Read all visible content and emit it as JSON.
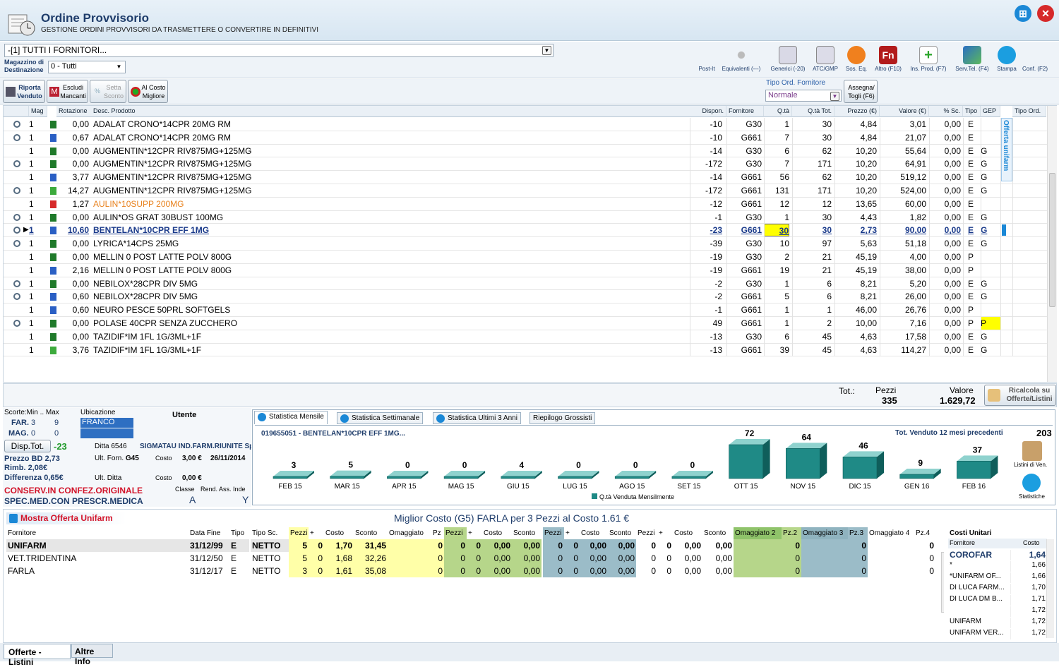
{
  "header": {
    "title": "Ordine Provvisorio",
    "subtitle": "GESTIONE ORDINI PROVVISORI DA TRASMETTERE O CONVERTIRE IN DEFINITIVI"
  },
  "toolbar": {
    "fornitori": "-[1] TUTTI I FORNITORI...",
    "mag_label": "Magazzino di Destinazione",
    "mag_value": "0 - Tutti",
    "tools": [
      "Post-It",
      "Equivalenti (---)",
      "Generici (-20)",
      "ATC/GMP",
      "Sos. Eq.",
      "Altro (F10)",
      "Ins. Prod. (F7)",
      "Serv.Tel. (F4)",
      "Stampa",
      "Conf. (F2)"
    ]
  },
  "bar2": {
    "riporta": "Riporta Venduto",
    "escludi": "Escludi Mancanti",
    "setta": "Setta Sconto",
    "alcosto": "Al Costo Migliore",
    "tipo_ord_label": "Tipo Ord. Fornitore",
    "tipo_ord_value": "Normale",
    "assegna": "Assegna/ Togli (F6)"
  },
  "grid": {
    "headers": [
      "Mag",
      "Rotazione",
      "Desc. Prodotto",
      "Dispon.",
      "Fornitore",
      "Q.tà",
      "Q.tà Tot.",
      "Prezzo (€)",
      "Valore (€)",
      "% Sc.",
      "Tipo",
      "GEP",
      "Tipo Ord."
    ],
    "side_label": "Offerta unifarm",
    "rows": [
      [
        "1",
        "0,00",
        "ADALAT CRONO*14CPR 20MG RM",
        "-10",
        "G30",
        "1",
        "30",
        "4,84",
        "3,01",
        "0,00",
        "E",
        ""
      ],
      [
        "1",
        "0,67",
        "ADALAT CRONO*14CPR 20MG RM",
        "-10",
        "G661",
        "7",
        "30",
        "4,84",
        "21,07",
        "0,00",
        "E",
        ""
      ],
      [
        "1",
        "0,00",
        "AUGMENTIN*12CPR RIV875MG+125MG",
        "-14",
        "G30",
        "6",
        "62",
        "10,20",
        "55,64",
        "0,00",
        "E",
        "G"
      ],
      [
        "1",
        "0,00",
        "AUGMENTIN*12CPR RIV875MG+125MG",
        "-172",
        "G30",
        "7",
        "171",
        "10,20",
        "64,91",
        "0,00",
        "E",
        "G"
      ],
      [
        "1",
        "3,77",
        "AUGMENTIN*12CPR RIV875MG+125MG",
        "-14",
        "G661",
        "56",
        "62",
        "10,20",
        "519,12",
        "0,00",
        "E",
        "G"
      ],
      [
        "1",
        "14,27",
        "AUGMENTIN*12CPR RIV875MG+125MG",
        "-172",
        "G661",
        "131",
        "171",
        "10,20",
        "524,00",
        "0,00",
        "E",
        "G"
      ],
      [
        "1",
        "1,27",
        "AULIN*10SUPP 200MG",
        "-12",
        "G661",
        "12",
        "12",
        "13,65",
        "60,00",
        "0,00",
        "E",
        ""
      ],
      [
        "1",
        "0,00",
        "AULIN*OS GRAT 30BUST 100MG",
        "-1",
        "G30",
        "1",
        "30",
        "4,43",
        "1,82",
        "0,00",
        "E",
        "G"
      ],
      [
        "1",
        "10,60",
        "BENTELAN*10CPR EFF 1MG",
        "-23",
        "G661",
        "30",
        "30",
        "2,73",
        "90,00",
        "0,00",
        "E",
        "G"
      ],
      [
        "1",
        "0,00",
        "LYRICA*14CPS 25MG",
        "-39",
        "G30",
        "10",
        "97",
        "5,63",
        "51,18",
        "0,00",
        "E",
        "G"
      ],
      [
        "1",
        "0,00",
        "MELLIN 0 POST LATTE POLV 800G",
        "-19",
        "G30",
        "2",
        "21",
        "45,19",
        "4,00",
        "0,00",
        "P",
        ""
      ],
      [
        "1",
        "2,16",
        "MELLIN 0 POST LATTE POLV 800G",
        "-19",
        "G661",
        "19",
        "21",
        "45,19",
        "38,00",
        "0,00",
        "P",
        ""
      ],
      [
        "1",
        "0,00",
        "NEBILOX*28CPR DIV 5MG",
        "-2",
        "G30",
        "1",
        "6",
        "8,21",
        "5,20",
        "0,00",
        "E",
        "G"
      ],
      [
        "1",
        "0,60",
        "NEBILOX*28CPR DIV 5MG",
        "-2",
        "G661",
        "5",
        "6",
        "8,21",
        "26,00",
        "0,00",
        "E",
        "G"
      ],
      [
        "1",
        "0,60",
        "NEURO PESCE 50PRL SOFTGELS",
        "-1",
        "G661",
        "1",
        "1",
        "46,00",
        "26,76",
        "0,00",
        "P",
        ""
      ],
      [
        "1",
        "0,00",
        "POLASE 40CPR SENZA ZUCCHERO",
        "49",
        "G661",
        "1",
        "2",
        "10,00",
        "7,16",
        "0,00",
        "P",
        "P"
      ],
      [
        "1",
        "0,00",
        "TAZIDIF*IM 1FL 1G/3ML+1F",
        "-13",
        "G30",
        "6",
        "45",
        "4,63",
        "17,58",
        "0,00",
        "E",
        "G"
      ],
      [
        "1",
        "3,76",
        "TAZIDIF*IM 1FL 1G/3ML+1F",
        "-13",
        "G661",
        "39",
        "45",
        "4,63",
        "114,27",
        "0,00",
        "E",
        "G"
      ]
    ]
  },
  "totals": {
    "tot_label": "Tot.:",
    "pezzi_label": "Pezzi",
    "pezzi": "335",
    "valore_label": "Valore",
    "valore": "1.629,72",
    "ricalcola": "Ricalcola su Offerte/Listini"
  },
  "info": {
    "scorte": "Scorte:Min .. Max",
    "ubicazione": "Ubicazione",
    "utente": "Utente",
    "far": "FAR.",
    "far_min": "3",
    "far_max": "9",
    "far_ubic": "FRANCO",
    "mag": "MAG.",
    "mag_min": "0",
    "mag_max": "0",
    "disp_btn": "Disp.Tot.",
    "disp_val": "-23",
    "ditta_label": "Ditta 6546",
    "ditta": "SIGMATAU IND.FARM.RIUNITE Sp",
    "prezzo_bd_label": "Prezzo BD",
    "prezzo_bd": "2,73",
    "ult_forn_label": "Ult. Forn.",
    "ult_forn": "G45",
    "costo_label": "Costo",
    "costo1": "3,00 €",
    "data1": "26/11/2014",
    "rimb_label": "Rimb.",
    "rimb": "2,08€",
    "differenza_label": "Differenza",
    "differenza": "0,65€",
    "ult_ditta_label": "Ult. Ditta",
    "costo2": "0,00 €",
    "conserv": "CONSERV.IN CONFEZ.ORIGINALE",
    "spec": "SPEC.MED.CON PRESCR.MEDICA",
    "classe_label": "Classe",
    "classe": "A",
    "rend_label": "Rend. Ass. Inde",
    "rend": "Y"
  },
  "stats": {
    "tabs": [
      "Statistica Mensile",
      "Statistica Settimanale",
      "Statistica Ultimi 3 Anni",
      "Riepilogo Grossisti"
    ],
    "product": "019655051 - BENTELAN*10CPR EFF 1MG...",
    "tot_label": "Tot. Venduto 12 mesi precedenti",
    "tot": "203",
    "listini": "Listini di Ven.",
    "statistiche": "Statistiche"
  },
  "chart_data": {
    "type": "bar",
    "categories": [
      "FEB 15",
      "MAR 15",
      "APR 15",
      "MAG 15",
      "GIU 15",
      "LUG 15",
      "AGO 15",
      "SET 15",
      "OTT 15",
      "NOV 15",
      "DIC 15",
      "GEN 16",
      "FEB 16"
    ],
    "series": [
      {
        "name": "Q.tà Venduta Mensilmente",
        "values": [
          3,
          5,
          0,
          0,
          4,
          0,
          0,
          0,
          72,
          64,
          46,
          9,
          37
        ]
      }
    ],
    "color": "#1f8a86"
  },
  "offer": {
    "mostra": "Mostra Offerta Unifarm",
    "title": "Miglior Costo (G5) FARLA per 3 Pezzi al Costo 1.61 €",
    "headers": [
      "Fornitore",
      "Data Fine",
      "Tipo",
      "Tipo Sc.",
      "Pezzi",
      "+",
      "Costo",
      "Sconto",
      "Omaggiato",
      "Pz",
      "Pezzi",
      "+",
      "Costo",
      "Sconto",
      "Pezzi",
      "+",
      "Costo",
      "Sconto",
      "Pezzi",
      "+",
      "Costo",
      "Sconto",
      "Omaggiato 2",
      "Pz.2",
      "Omaggiato 3",
      "Pz.3",
      "Omaggiato 4",
      "Pz.4"
    ],
    "rows": [
      [
        "UNIFARM",
        "31/12/99",
        "E",
        "NETTO",
        "5",
        "0",
        "1,70",
        "31,45",
        "",
        "0",
        "0",
        "0",
        "0,00",
        "0,00",
        "0",
        "0",
        "0,00",
        "0,00",
        "0",
        "0",
        "0,00",
        "0,00",
        "",
        "0",
        "",
        "0",
        "",
        "0"
      ],
      [
        "VET.TRIDENTINA",
        "31/12/50",
        "E",
        "NETTO",
        "5",
        "0",
        "1,68",
        "32,26",
        "",
        "0",
        "0",
        "0",
        "0,00",
        "0,00",
        "0",
        "0",
        "0,00",
        "0,00",
        "0",
        "0",
        "0,00",
        "0,00",
        "",
        "0",
        "",
        "0",
        "",
        "0"
      ],
      [
        "FARLA",
        "31/12/17",
        "E",
        "NETTO",
        "3",
        "0",
        "1,61",
        "35,08",
        "",
        "0",
        "0",
        "0",
        "0,00",
        "0,00",
        "0",
        "0",
        "0,00",
        "0,00",
        "0",
        "0",
        "0,00",
        "0,00",
        "",
        "0",
        "",
        "0",
        "",
        "0"
      ]
    ]
  },
  "costi": {
    "title": "Costi Unitari",
    "h_forn": "Fornitore",
    "h_costo": "Costo",
    "rows": [
      [
        "COROFAR",
        "1,64"
      ],
      [
        "*",
        "1,66"
      ],
      [
        "*UNIFARM OF...",
        "1,66"
      ],
      [
        "DI LUCA FARM...",
        "1,70"
      ],
      [
        "DI LUCA DM B...",
        "1,71"
      ],
      [
        "",
        "1,72"
      ],
      [
        "UNIFARM",
        "1,72"
      ],
      [
        "UNIFARM VER...",
        "1,72"
      ]
    ]
  },
  "bottom_tabs": [
    "Offerte - Listini",
    "Altre Info"
  ]
}
